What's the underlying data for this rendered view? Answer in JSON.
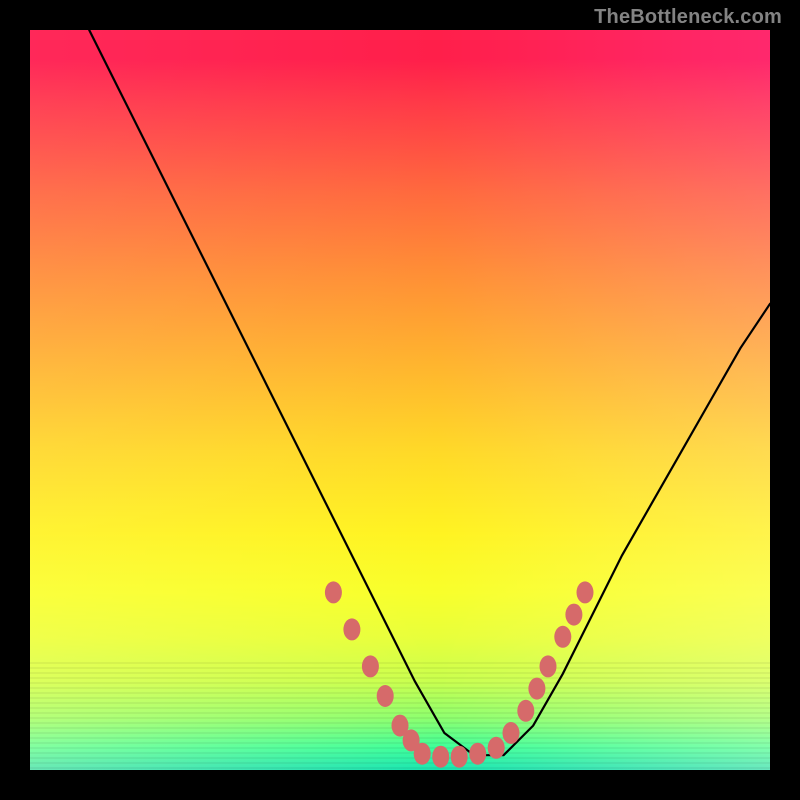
{
  "watermark": "TheBottleneck.com",
  "chart_data": {
    "type": "line",
    "title": "",
    "xlabel": "",
    "ylabel": "",
    "xlim": [
      0,
      100
    ],
    "ylim": [
      0,
      100
    ],
    "grid": false,
    "legend": false,
    "series": [
      {
        "name": "curve",
        "x": [
          8,
          12,
          16,
          20,
          24,
          28,
          32,
          36,
          40,
          44,
          48,
          52,
          56,
          60,
          64,
          68,
          72,
          76,
          80,
          84,
          88,
          92,
          96,
          100
        ],
        "values": [
          100,
          92,
          84,
          76,
          68,
          60,
          52,
          44,
          36,
          28,
          20,
          12,
          5,
          2,
          2,
          6,
          13,
          21,
          29,
          36,
          43,
          50,
          57,
          63
        ]
      }
    ],
    "highlight_clusters": [
      {
        "name": "left-arm-dots",
        "x": [
          41,
          43.5,
          46,
          48,
          50,
          51.5
        ],
        "values": [
          24,
          19,
          14,
          10,
          6,
          4
        ]
      },
      {
        "name": "valley-dots",
        "x": [
          53,
          55.5,
          58,
          60.5,
          63,
          65
        ],
        "values": [
          2.2,
          1.8,
          1.8,
          2.2,
          3,
          5
        ]
      },
      {
        "name": "right-arm-dots",
        "x": [
          67,
          68.5,
          70,
          72,
          73.5,
          75
        ],
        "values": [
          8,
          11,
          14,
          18,
          21,
          24
        ]
      }
    ],
    "colors": {
      "curve": "#000000",
      "dots": "#d66a6a"
    }
  }
}
